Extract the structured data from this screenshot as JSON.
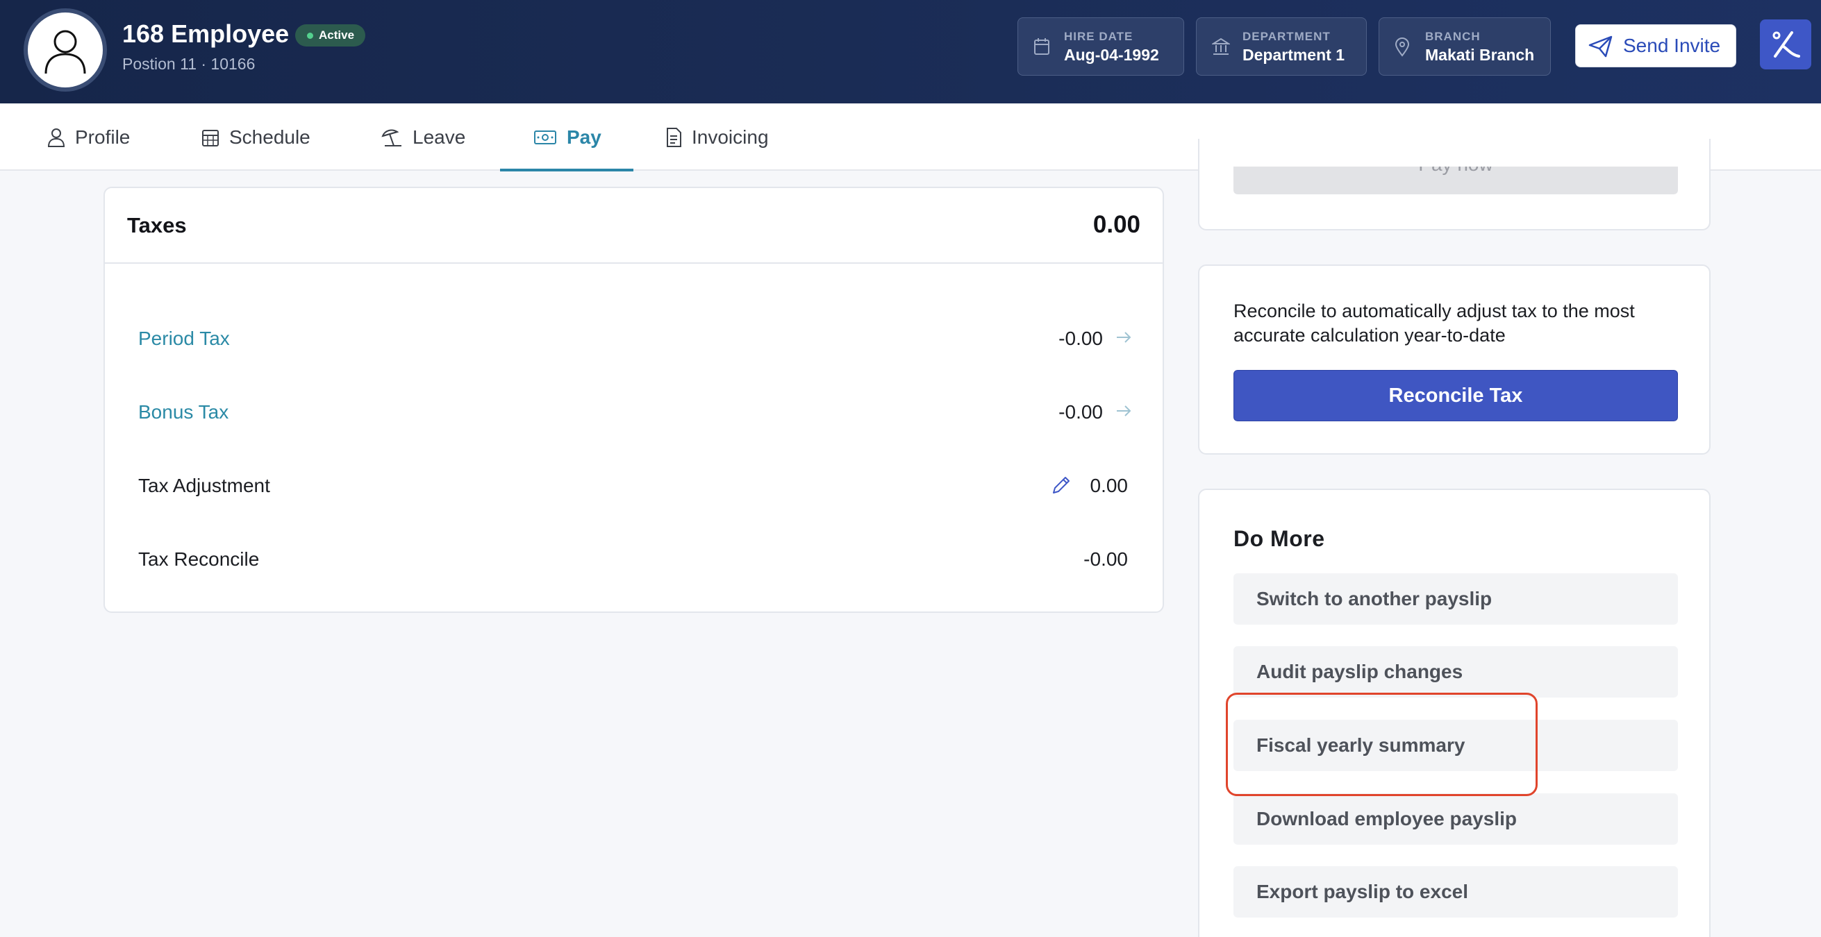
{
  "header": {
    "employee_name": "168 Employee",
    "status": "Active",
    "subtitle": "Postion 11 · 10166",
    "info": [
      {
        "label": "HIRE DATE",
        "value": "Aug-04-1992",
        "icon": "calendar-icon"
      },
      {
        "label": "DEPARTMENT",
        "value": "Department 1",
        "icon": "bank-icon"
      },
      {
        "label": "BRANCH",
        "value": "Makati Branch",
        "icon": "location-pin-icon"
      }
    ],
    "send_invite_label": "Send Invite"
  },
  "tabs": [
    {
      "label": "Profile",
      "icon": "user-icon"
    },
    {
      "label": "Schedule",
      "icon": "calendar-grid-icon"
    },
    {
      "label": "Leave",
      "icon": "beach-umbrella-icon"
    },
    {
      "label": "Pay",
      "icon": "money-icon",
      "active": true
    },
    {
      "label": "Invoicing",
      "icon": "document-icon"
    }
  ],
  "taxes": {
    "title": "Taxes",
    "total": "0.00",
    "rows": [
      {
        "label": "Period Tax",
        "value": "-0.00",
        "link": true
      },
      {
        "label": "Bonus Tax",
        "value": "-0.00",
        "link": true
      },
      {
        "label": "Tax Adjustment",
        "value": "0.00",
        "editable": true
      },
      {
        "label": "Tax Reconcile",
        "value": "-0.00"
      }
    ]
  },
  "pay_card": {
    "button_label": "Pay now"
  },
  "reconcile": {
    "description": "Reconcile to automatically adjust tax to the most accurate calculation year-to-date",
    "button_label": "Reconcile Tax"
  },
  "do_more": {
    "title": "Do More",
    "items": [
      "Switch to another payslip",
      "Audit payslip changes",
      "Fiscal yearly summary",
      "Download employee payslip",
      "Export payslip to excel"
    ]
  },
  "colors": {
    "header_bg": "#1b2d57",
    "accent_teal": "#2b86a8",
    "primary_button": "#3f56c2",
    "highlight": "#e0452c"
  }
}
